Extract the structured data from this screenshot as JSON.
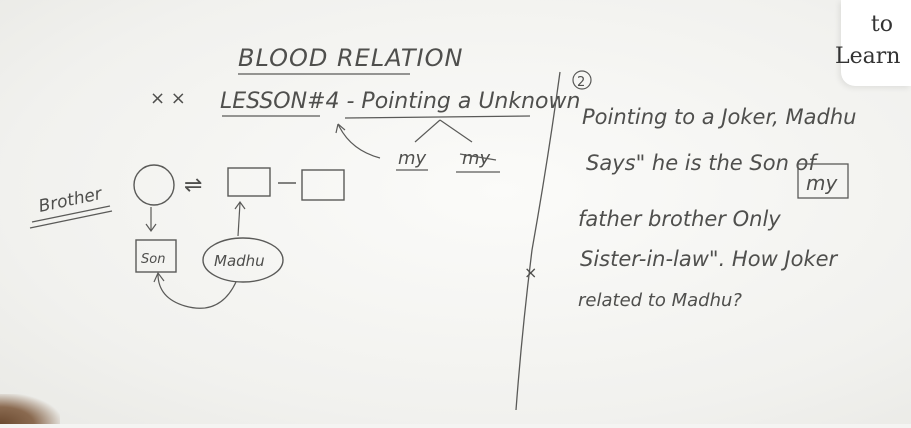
{
  "title": {
    "line1": "BLOOD RELATION",
    "line2": "LESSON#4 - Pointing a Unknown"
  },
  "cross_marks": "× ×",
  "arrow_labels": {
    "left": "my",
    "right": "my"
  },
  "diagram": {
    "brother_label": "Brother",
    "son_label": "Son",
    "madhu_label": "Madhu",
    "arrows_symbol": "⇌"
  },
  "question": {
    "number": "2",
    "line1": "Pointing to a Joker, Madhu",
    "line2a": "Says\" he is the Son of",
    "line2_boxed": "my",
    "line3": "father brother Only",
    "line4": "Sister-in-law\". How Joker",
    "line5": "related to Madhu?"
  },
  "divider_mark": "×",
  "corner": {
    "line1": "to",
    "line2": "Learn"
  }
}
